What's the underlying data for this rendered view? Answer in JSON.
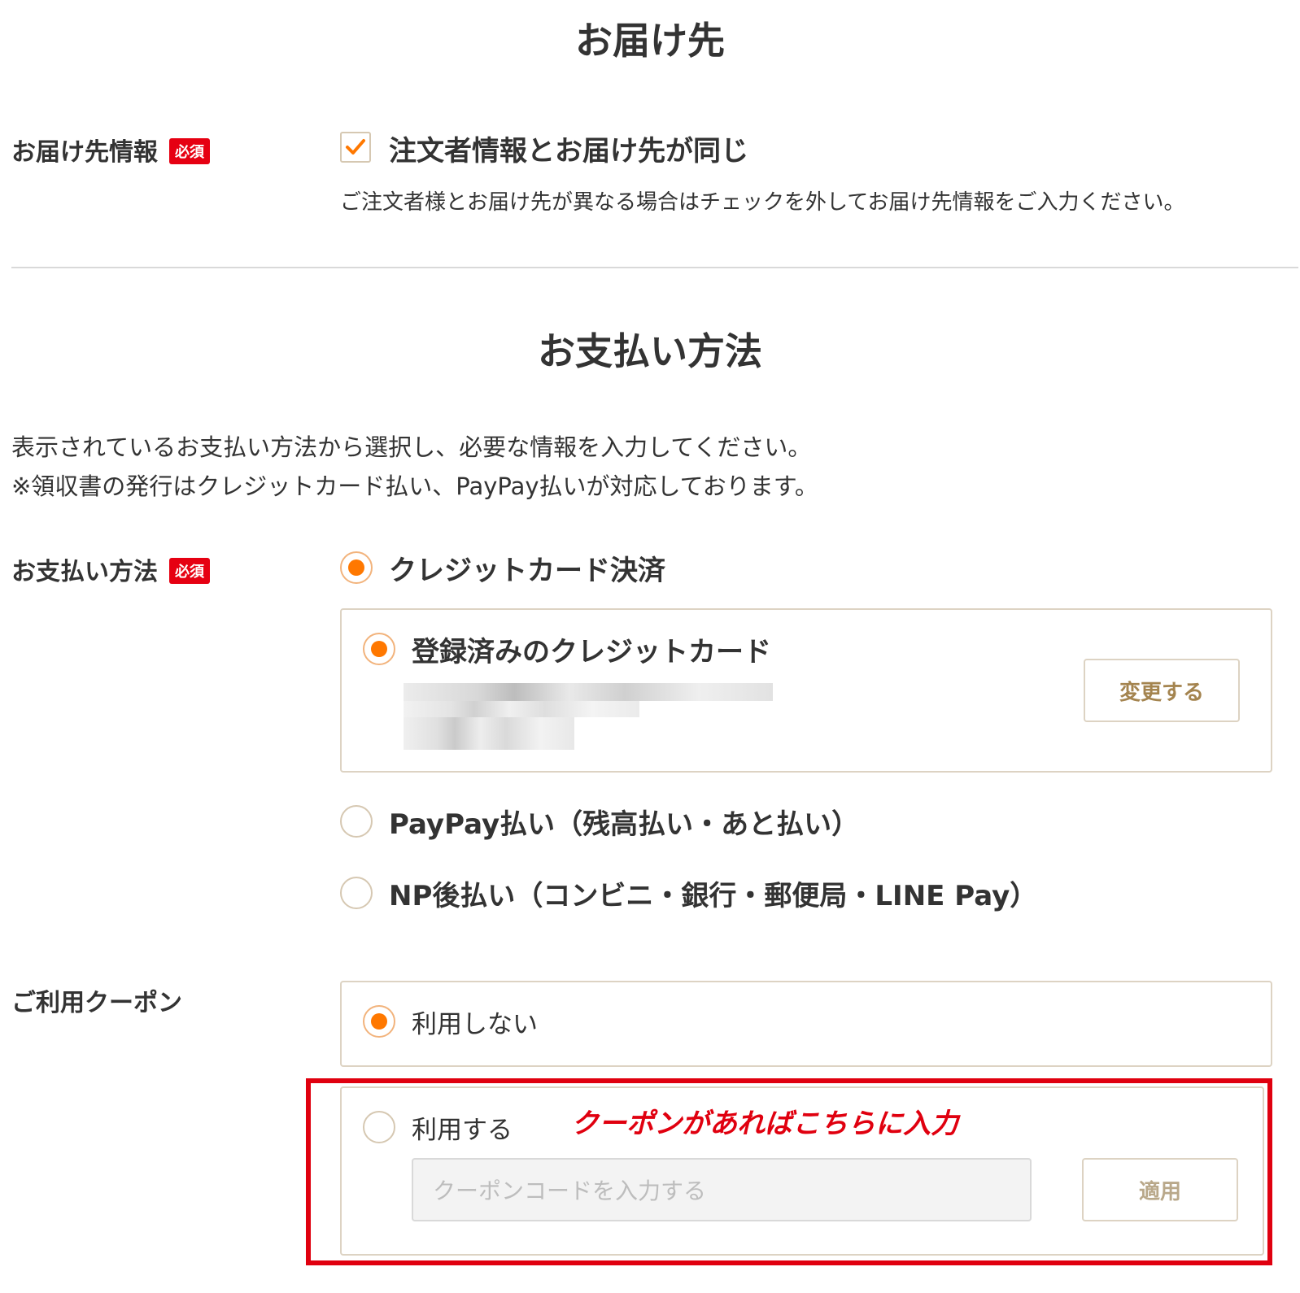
{
  "delivery": {
    "title": "お届け先",
    "row_label": "お届け先情報",
    "required_badge": "必須",
    "same_as_orderer_label": "注文者情報とお届け先が同じ",
    "same_as_orderer_checked": true,
    "note": "ご注文者様とお届け先が異なる場合はチェックを外してお届け先情報をご入力ください。"
  },
  "payment": {
    "title": "お支払い方法",
    "intro_line1": "表示されているお支払い方法から選択し、必要な情報を入力してください。",
    "intro_line2": "※領収書の発行はクレジットカード払い、PayPay払いが対応しております。",
    "row_label": "お支払い方法",
    "required_badge": "必須",
    "options": [
      {
        "label": "クレジットカード決済",
        "selected": true
      },
      {
        "label": "PayPay払い（残高払い・あと払い）",
        "selected": false
      },
      {
        "label": "NP後払い（コンビニ・銀行・郵便局・LINE Pay）",
        "selected": false
      }
    ],
    "saved_card": {
      "label": "登録済みのクレジットカード",
      "selected": true,
      "change_button": "変更する"
    }
  },
  "coupon": {
    "row_label": "ご利用クーポン",
    "options": [
      {
        "label": "利用しない",
        "selected": true
      },
      {
        "label": "利用する",
        "selected": false
      }
    ],
    "input_placeholder": "クーポンコードを入力する",
    "apply_button": "適用",
    "annotation": "クーポンがあればこちらに入力"
  },
  "colors": {
    "accent": "#ff7800",
    "required_badge": "#e60012",
    "highlight": "#e0000f",
    "button_text": "#a4844f"
  }
}
